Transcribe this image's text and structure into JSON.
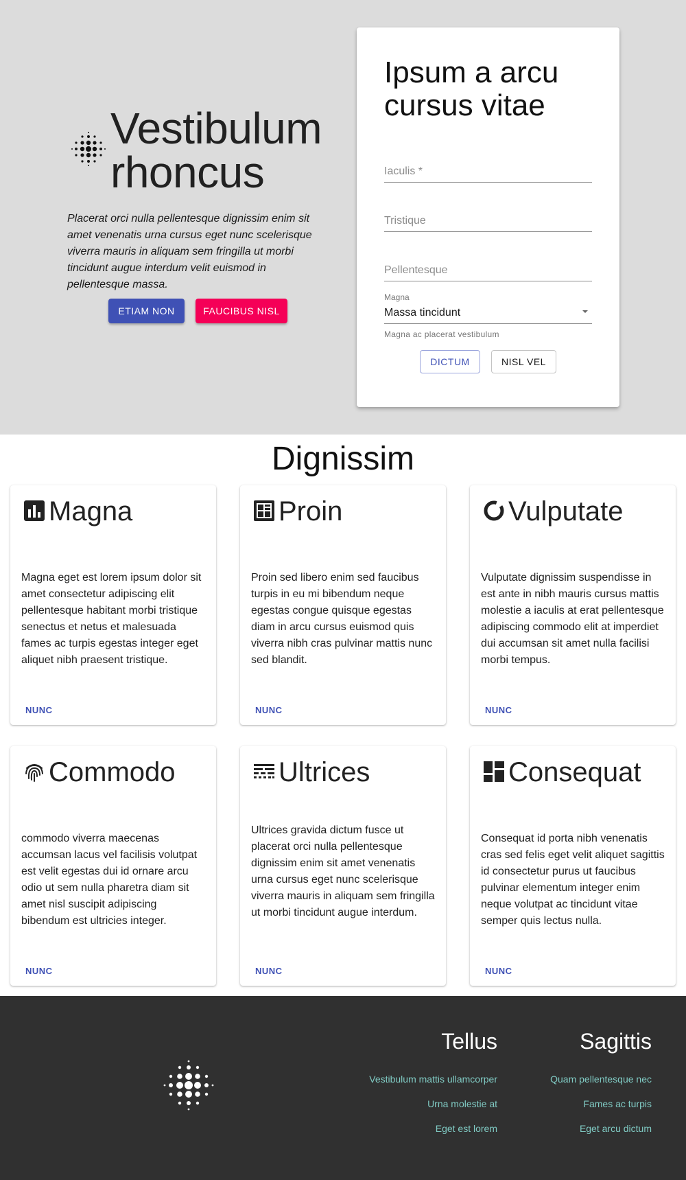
{
  "hero": {
    "title_line1": "Vestibulum",
    "title_line2": "rhoncus",
    "description": "Placerat orci nulla pellentesque dignissim enim sit amet venenatis urna cursus eget nunc scelerisque viverra mauris in aliquam sem fringilla ut morbi tincidunt augue interdum velit euismod in pellentesque massa.",
    "primary_button": "ETIAM NON",
    "accent_button": "FAUCIBUS NISL"
  },
  "form": {
    "title": "Ipsum a arcu cursus vitae",
    "field1_placeholder": "Iaculis *",
    "field2_placeholder": "Tristique",
    "field3_placeholder": "Pellentesque",
    "select_label": "Magna",
    "select_value": "Massa tincidunt",
    "helper_text": "Magna ac placerat vestibulum",
    "button_primary": "DICTUM",
    "button_secondary": "NISL VEL"
  },
  "section": {
    "title": "Dignissim",
    "cards": [
      {
        "icon": "bar-chart-icon",
        "title": "Magna",
        "text": "Magna eget est lorem ipsum dolor sit amet consectetur adipiscing elit pellentesque habitant morbi tristique senectus et netus et malesuada fames ac turpis egestas integer eget aliquet nibh praesent tristique.",
        "link": "NUNC"
      },
      {
        "icon": "dashboard-grid-icon",
        "title": "Proin",
        "text": "Proin sed libero enim sed faucibus turpis in eu mi bibendum neque egestas congue quisque egestas diam in arcu cursus euismod quis viverra nibh cras pulvinar mattis nunc sed blandit.",
        "link": "NUNC"
      },
      {
        "icon": "donut-chart-icon",
        "title": "Vulputate",
        "text": "Vulputate dignissim suspendisse in est ante in nibh mauris cursus mattis molestie a iaculis at erat pellentesque adipiscing commodo elit at imperdiet dui accumsan sit amet nulla facilisi morbi tempus.",
        "link": "NUNC"
      },
      {
        "icon": "fingerprint-icon",
        "title": "Commodo",
        "text": "commodo viverra maecenas accumsan lacus vel facilisis volutpat est velit egestas dui id ornare arcu odio ut sem nulla pharetra diam sit amet nisl suscipit adipiscing bibendum est ultricies integer.",
        "link": "NUNC"
      },
      {
        "icon": "line-style-icon",
        "title": "Ultrices",
        "text": "Ultrices gravida dictum fusce ut placerat orci nulla pellentesque dignissim enim sit amet venenatis urna cursus eget nunc scelerisque viverra mauris in aliquam sem fringilla ut morbi tincidunt augue interdum.",
        "link": "NUNC"
      },
      {
        "icon": "dashboard-tiles-icon",
        "title": "Consequat",
        "text": "Consequat id porta nibh venenatis cras sed felis eget velit aliquet sagittis id consectetur purus ut faucibus pulvinar elementum integer enim neque volutpat ac tincidunt vitae semper quis lectus nulla.",
        "link": "NUNC"
      }
    ]
  },
  "footer": {
    "col1": {
      "title": "Tellus",
      "links": [
        "Vestibulum mattis ullamcorper",
        "Urna molestie at",
        "Eget est lorem"
      ]
    },
    "col2": {
      "title": "Sagittis",
      "links": [
        "Quam pellentesque nec",
        "Fames ac turpis",
        "Eget arcu dictum"
      ]
    }
  },
  "colors": {
    "hero_bg": "#dcdcdc",
    "primary": "#3f51b5",
    "accent": "#f50057",
    "footer_bg": "#303030",
    "footer_link": "#80cbc4"
  }
}
